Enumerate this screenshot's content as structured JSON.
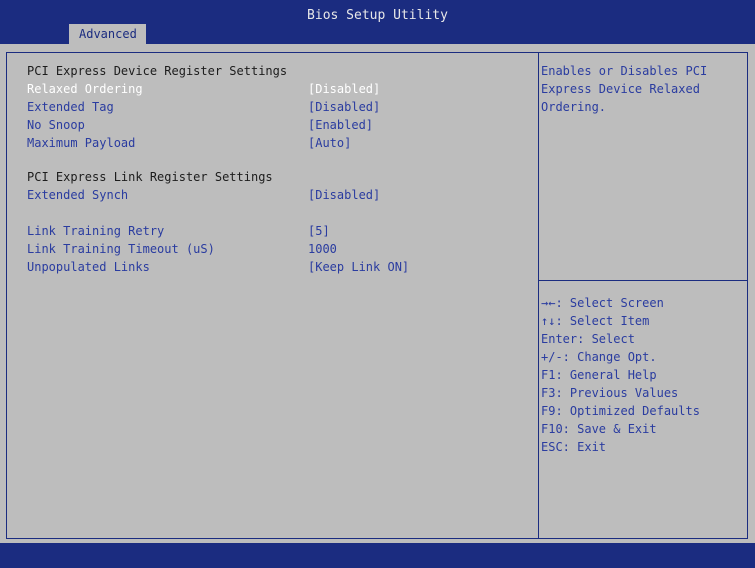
{
  "app_title": "Bios Setup Utility",
  "tabs": [
    {
      "label": "Advanced"
    }
  ],
  "settings": {
    "section1_title": "PCI Express Device Register Settings",
    "relaxed_ordering": {
      "label": "Relaxed Ordering",
      "value": "[Disabled]"
    },
    "extended_tag": {
      "label": "Extended Tag",
      "value": "[Disabled]"
    },
    "no_snoop": {
      "label": "No Snoop",
      "value": "[Enabled]"
    },
    "maximum_payload": {
      "label": "Maximum Payload",
      "value": "[Auto]"
    },
    "section2_title": "PCI Express Link Register Settings",
    "extended_synch": {
      "label": "Extended Synch",
      "value": "[Disabled]"
    },
    "link_training_retry": {
      "label": "Link Training Retry",
      "value": "[5]"
    },
    "link_training_timeout": {
      "label": "Link Training Timeout (uS)",
      "value": "1000"
    },
    "unpopulated_links": {
      "label": "Unpopulated Links",
      "value": "[Keep Link ON]"
    }
  },
  "help": {
    "description_lines": [
      "Enables or Disables PCI",
      "Express Device Relaxed",
      "Ordering."
    ]
  },
  "keys": [
    "→←: Select Screen",
    "↑↓: Select Item",
    "Enter: Select",
    "+/-: Change Opt.",
    "F1: General Help",
    "F3: Previous Values",
    "F9: Optimized Defaults",
    "F10: Save & Exit",
    "ESC: Exit"
  ],
  "colors": {
    "frame_blue": "#1b2c80",
    "panel_gray": "#bdbdbd",
    "item_blue": "#2a3ca0",
    "selected_white": "#ffffff"
  }
}
